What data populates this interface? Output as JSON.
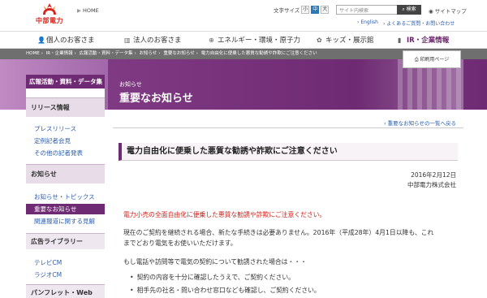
{
  "header": {
    "logo_text": "中部電力",
    "home": "HOME",
    "text_size_label": "文字サイズ",
    "text_size_options": [
      "小",
      "中",
      "大"
    ],
    "search_placeholder": "サイト内検索",
    "search_button": "検索",
    "sitemap": "サイトマップ",
    "sub_links": [
      "English",
      "よくあるご質問・お問い合わせ"
    ]
  },
  "gnav": {
    "items": [
      {
        "label": "個人のお客さま",
        "icon": "person-icon"
      },
      {
        "label": "法人のお客さま",
        "icon": "building-icon"
      },
      {
        "label": "エネルギー・環境・原子力",
        "icon": "globe-icon"
      },
      {
        "label": "キッズ・展示館",
        "icon": "kids-icon"
      },
      {
        "label": "IR・企業情報",
        "icon": "chart-icon"
      }
    ]
  },
  "breadcrumb": {
    "items": [
      "HOME",
      "IR・企業情報",
      "広報活動・資料・データ集",
      "お知らせ",
      "重要なお知らせ",
      "電力自由化に便乗した悪質な勧誘や詐欺にご注意ください"
    ],
    "separator": "›",
    "print_label": "印刷用ページ"
  },
  "band": {
    "small": "お知らせ",
    "title": "重要なお知らせ"
  },
  "sidebar": {
    "head": "広報活動・資料・データ集",
    "section1": "リリース情報",
    "section1_items": [
      "プレスリリース",
      "定例記者会見",
      "その他の記者発表"
    ],
    "section2": "お知らせ",
    "section2_items": [
      "お知らせ・トピックス",
      "重要なお知らせ",
      "関連報道に関する見解"
    ],
    "section3": "広告ライブラリー",
    "section3_items": [
      "テレビCM",
      "ラジオCM"
    ],
    "section4": "パンフレット・Web"
  },
  "main": {
    "ichiran": "重要なお知らせの一覧へ戻る",
    "headline": "電力自由化に便乗した悪質な勧誘や詐欺にご注意ください",
    "date": "2016年2月12日",
    "company": "中部電力株式会社",
    "alert": "電力小売の全面自由化に便乗した悪質な勧誘や詐欺にご注意ください。",
    "para1_line1": "現在のご契約を継続される場合、新たな手続きは必要ありません。2016年（平成28年）4月1日以降も、これ",
    "para1_line2": "までどおり電気をお使いいただけます。",
    "para2": "もし電話や訪問等で電気の契約について勧誘された場合は・・・",
    "bullets": [
      "契約の内容を十分に確認したうえで、ご契約ください。",
      "相手先の社名・問い合わせ窓口なども確認し、ご契約ください。"
    ]
  }
}
